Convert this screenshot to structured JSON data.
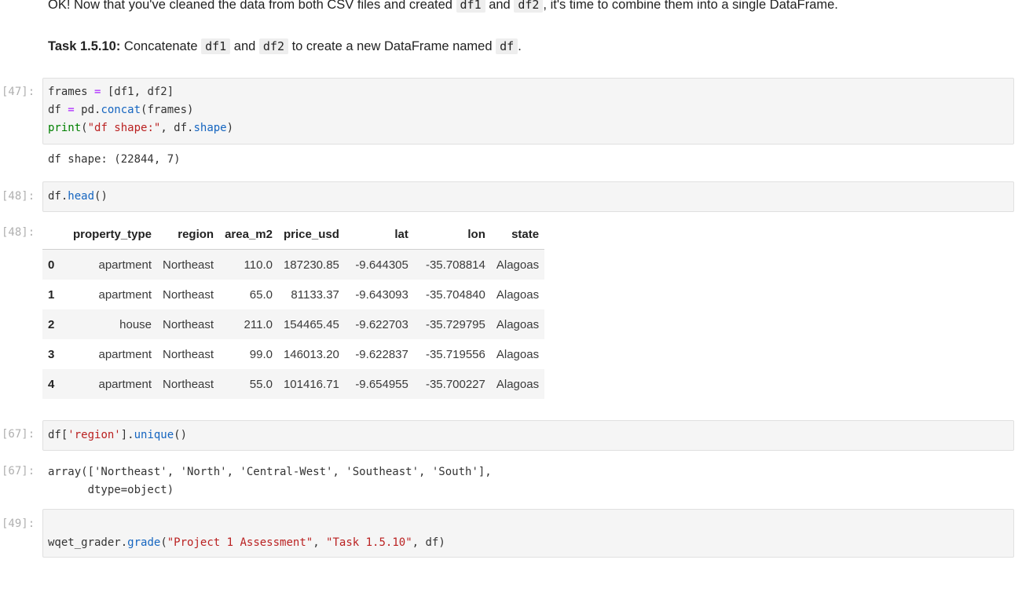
{
  "markdown": {
    "intro_prefix": "OK! Now that you've cleaned the data from both CSV files and created ",
    "intro_code1": "df1",
    "intro_and": " and ",
    "intro_code2": "df2",
    "intro_suffix": ", it's time to combine them into a single DataFrame.",
    "task_label": "Task 1.5.10:",
    "task_text1": " Concatenate ",
    "task_code1": "df1",
    "task_and": " and ",
    "task_code2": "df2",
    "task_text2": " to create a new DataFrame named ",
    "task_code3": "df",
    "task_end": "."
  },
  "cells": [
    {
      "prompt": "[47]:",
      "code": {
        "l1_a": "frames ",
        "l1_op": "=",
        "l1_b": " [df1, df2]",
        "l2_a": "df ",
        "l2_op": "=",
        "l2_b": " pd.",
        "l2_fn": "concat",
        "l2_c": "(frames)",
        "l3_fn": "print",
        "l3_a": "(",
        "l3_str": "\"df shape:\"",
        "l3_b": ", df.",
        "l3_attr": "shape",
        "l3_c": ")"
      },
      "output": "df shape: (22844, 7)"
    },
    {
      "prompt": "[48]:",
      "code": {
        "a": "df.",
        "fn": "head",
        "b": "()"
      },
      "out_prompt": "[48]:"
    },
    {
      "prompt": "[67]:",
      "code": {
        "a": "df[",
        "str": "'region'",
        "b": "].",
        "fn": "unique",
        "c": "()"
      },
      "out_prompt": "[67]:",
      "output": "array(['Northeast', 'North', 'Central-West', 'Southeast', 'South'],\n      dtype=object)"
    },
    {
      "prompt": "[49]:",
      "code": {
        "a": "wqet_grader.",
        "fn": "grade",
        "b": "(",
        "s1": "\"Project 1 Assessment\"",
        "c": ", ",
        "s2": "\"Task 1.5.10\"",
        "d": ", df)"
      }
    }
  ],
  "dataframe": {
    "columns": [
      "",
      "property_type",
      "region",
      "area_m2",
      "price_usd",
      "lat",
      "lon",
      "state"
    ],
    "rows": [
      [
        "0",
        "apartment",
        "Northeast",
        "110.0",
        "187230.85",
        "-9.644305",
        "-35.708814",
        "Alagoas"
      ],
      [
        "1",
        "apartment",
        "Northeast",
        "65.0",
        "81133.37",
        "-9.643093",
        "-35.704840",
        "Alagoas"
      ],
      [
        "2",
        "house",
        "Northeast",
        "211.0",
        "154465.45",
        "-9.622703",
        "-35.729795",
        "Alagoas"
      ],
      [
        "3",
        "apartment",
        "Northeast",
        "99.0",
        "146013.20",
        "-9.622837",
        "-35.719556",
        "Alagoas"
      ],
      [
        "4",
        "apartment",
        "Northeast",
        "55.0",
        "101416.71",
        "-9.654955",
        "-35.700227",
        "Alagoas"
      ]
    ]
  },
  "colors": {
    "operator": "#aa22ff",
    "function": "#1565c0",
    "string": "#ba2121",
    "builtin": "#008000",
    "prompt": "#b0b0b0",
    "cell_background": "#f5f5f5"
  }
}
